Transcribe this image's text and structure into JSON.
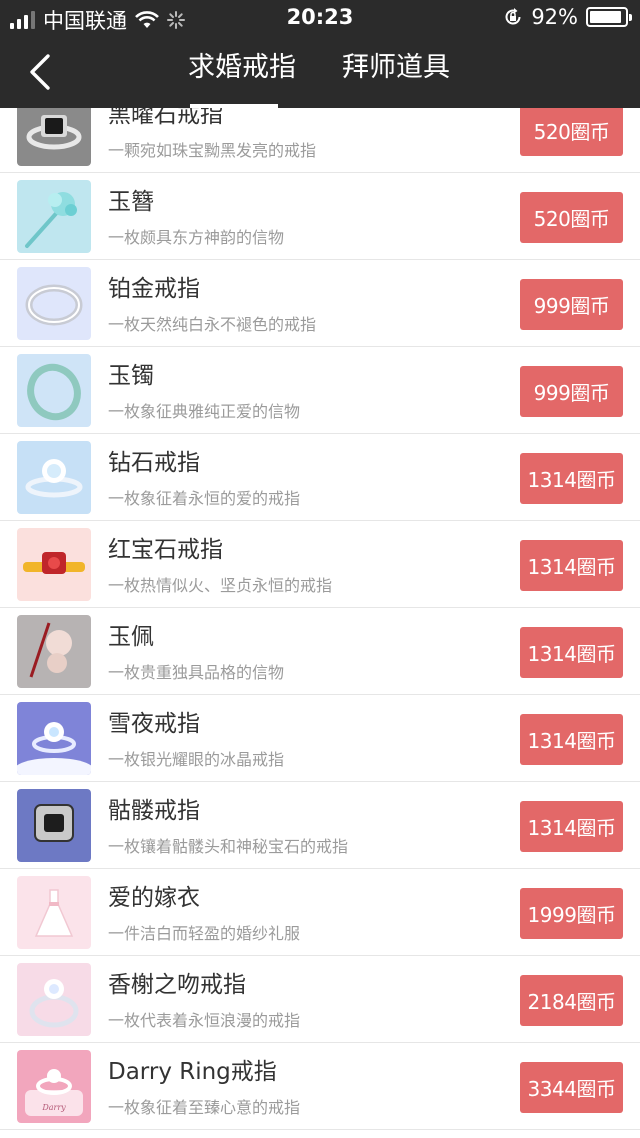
{
  "status_bar": {
    "carrier": "中国联通",
    "time": "20:23",
    "battery": "92%",
    "battery_level": 0.92
  },
  "nav": {
    "back_icon": "chevron-left-icon",
    "tabs": [
      {
        "label": "求婚戒指",
        "active": true
      },
      {
        "label": "拜师道具",
        "active": false
      }
    ]
  },
  "items": [
    {
      "name": "黑曜石戒指",
      "desc": "一颗宛如珠宝黝黑发亮的戒指",
      "price": "520圈币",
      "icon": "obsidian-ring-icon",
      "bg": "#8a8a8a"
    },
    {
      "name": "玉簪",
      "desc": "一枚颇具东方神韵的信物",
      "price": "520圈币",
      "icon": "jade-hairpin-icon",
      "bg": "#bfe6ef"
    },
    {
      "name": "铂金戒指",
      "desc": "一枚天然纯白永不褪色的戒指",
      "price": "999圈币",
      "icon": "platinum-ring-icon",
      "bg": "#dfe6fb"
    },
    {
      "name": "玉镯",
      "desc": "一枚象征典雅纯正爱的信物",
      "price": "999圈币",
      "icon": "jade-bracelet-icon",
      "bg": "#cfe4f7"
    },
    {
      "name": "钻石戒指",
      "desc": "一枚象征着永恒的爱的戒指",
      "price": "1314圈币",
      "icon": "diamond-ring-icon",
      "bg": "#c6e0f6"
    },
    {
      "name": "红宝石戒指",
      "desc": "一枚热情似火、坚贞永恒的戒指",
      "price": "1314圈币",
      "icon": "ruby-ring-icon",
      "bg": "#fbe0dd"
    },
    {
      "name": "玉佩",
      "desc": "一枚贵重独具品格的信物",
      "price": "1314圈币",
      "icon": "jade-pendant-icon",
      "bg": "#b7b3b3"
    },
    {
      "name": "雪夜戒指",
      "desc": "一枚银光耀眼的冰晶戒指",
      "price": "1314圈币",
      "icon": "snow-night-ring-icon",
      "bg": "#7f84d8"
    },
    {
      "name": "骷髅戒指",
      "desc": "一枚镶着骷髅头和神秘宝石的戒指",
      "price": "1314圈币",
      "icon": "skull-ring-icon",
      "bg": "#6d79c4"
    },
    {
      "name": "爱的嫁衣",
      "desc": "一件洁白而轻盈的婚纱礼服",
      "price": "1999圈币",
      "icon": "wedding-dress-icon",
      "bg": "#fbe3ea"
    },
    {
      "name": "香榭之吻戒指",
      "desc": "一枚代表着永恒浪漫的戒指",
      "price": "2184圈币",
      "icon": "champs-kiss-ring-icon",
      "bg": "#f7dbe7"
    },
    {
      "name": "Darry Ring戒指",
      "desc": "一枚象征着至臻心意的戒指",
      "price": "3344圈币",
      "icon": "darry-ring-icon",
      "bg": "#f2a6bd",
      "logo_text": "Darry"
    }
  ]
}
